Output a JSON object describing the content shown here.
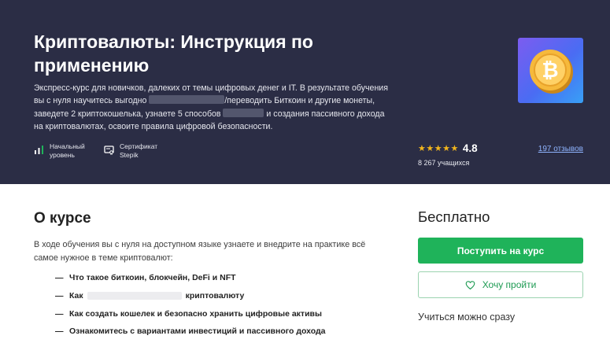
{
  "course": {
    "title": "Криптовалюты: Инструкция по применению",
    "description": {
      "part1": "Экспресс-курс для новичков, далеких от темы цифровых денег и IT. В результате обучения вы с нуля научитесь выгодно ",
      "part2": "/переводить Биткоин и другие монеты, заведете 2 криптокошелька, узнаете 5 способов ",
      "part3": " и создания пассивного дохода на криптовалютах, освоите правила цифровой безопасности."
    },
    "level_label": "Начальный\nуровень",
    "certificate_label": "Сертификат\nStepik",
    "stars": "★★★★★",
    "rating": "4.8",
    "learners": "8 267 учащихся",
    "reviews": "197 отзывов",
    "cover_icon": "bitcoin-coin-icon",
    "colors": {
      "hero_bg": "#2b2d45",
      "star": "#f2b61d",
      "accent_green": "#1fb35a",
      "link": "#8fb4ff"
    }
  },
  "about": {
    "title": "О курсе",
    "description": "В ходе обучения вы с нуля на доступном языке узнаете и внедрите на практике всё самое нужное в теме криптовалют:",
    "bullets": [
      "Что такое биткоин, блокчейн, DeFi и NFT",
      "Как",
      "криптовалюту",
      "Как создать кошелек и безопасно хранить цифровые активы",
      "Ознакомитесь с вариантами инвестиций и пассивного дохода"
    ]
  },
  "sidebar": {
    "price": "Бесплатно",
    "enroll_label": "Поступить на курс",
    "wishlist_label": "Хочу пройти",
    "start_note": "Учиться можно сразу"
  }
}
